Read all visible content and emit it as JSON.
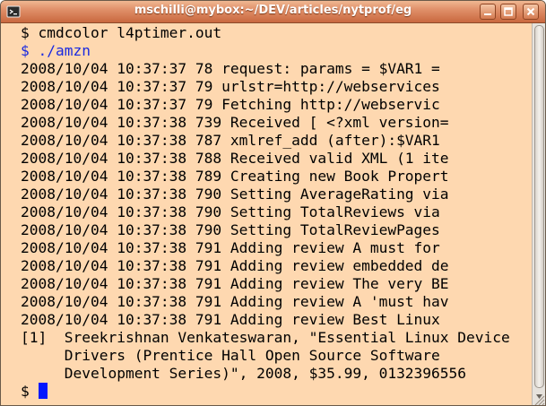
{
  "window": {
    "title": "mschilli@mybox:~/DEV/articles/nytprof/eg",
    "icon": "terminal-icon",
    "controls": [
      "minimize-icon",
      "maximize-icon",
      "close-icon"
    ],
    "background_color": "#fed8b0",
    "cursor_color": "#0018ff"
  },
  "terminal": {
    "lines": [
      "$ cmdcolor l4ptimer.out",
      "$ ./amzn",
      "2008/10/04 10:37:37 78 request: params = $VAR1 =",
      "2008/10/04 10:37:37 79 urlstr=http://webservices",
      "2008/10/04 10:37:37 79 Fetching http://webservic",
      "2008/10/04 10:37:38 739 Received [ <?xml version=",
      "2008/10/04 10:37:38 787 xmlref_add (after):$VAR1",
      "2008/10/04 10:37:38 788 Received valid XML (1 ite",
      "2008/10/04 10:37:38 789 Creating new Book Propert",
      "2008/10/04 10:37:38 790 Setting AverageRating via",
      "2008/10/04 10:37:38 790 Setting TotalReviews via",
      "2008/10/04 10:37:38 790 Setting TotalReviewPages",
      "2008/10/04 10:37:38 791 Adding review A must for",
      "2008/10/04 10:37:38 791 Adding review embedded de",
      "2008/10/04 10:37:38 791 Adding review The very BE",
      "2008/10/04 10:37:38 791 Adding review A 'must hav",
      "2008/10/04 10:37:38 791 Adding review Best Linux",
      "[1]  Sreekrishnan Venkateswaran, \"Essential Linux Device",
      "     Drivers (Prentice Hall Open Source Software",
      "     Development Series)\", 2008, $35.99, 0132396556",
      "$ "
    ]
  }
}
